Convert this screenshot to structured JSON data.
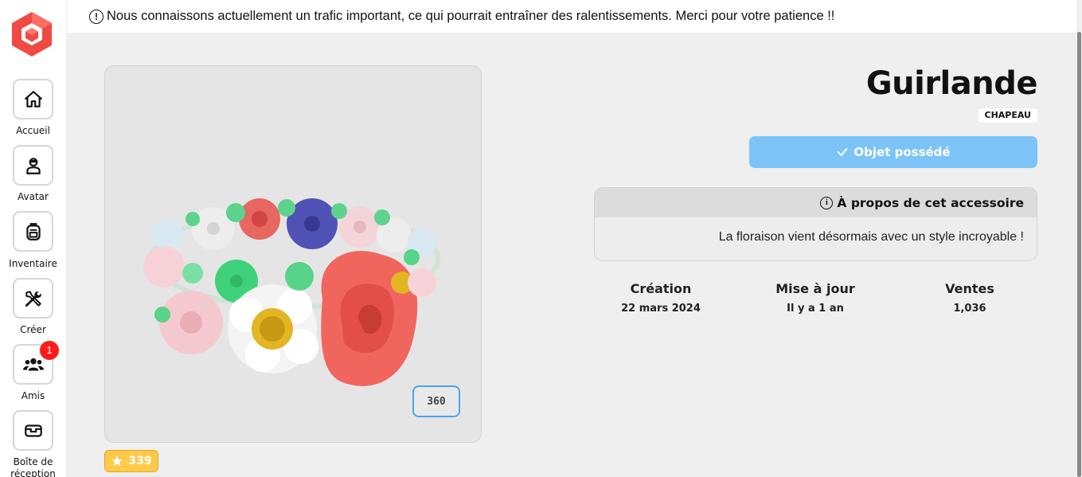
{
  "banner": {
    "icon": "exclamation-circle-icon",
    "text": "Nous connaissons actuellement un trafic important, ce qui pourrait entraîner des ralentissements. Merci pour votre patience !!"
  },
  "sidebar": {
    "logo": "hexagon-cube-logo",
    "accent_color": "#f04a44",
    "items": [
      {
        "label": "Accueil",
        "icon": "home-icon"
      },
      {
        "label": "Avatar",
        "icon": "avatar-icon"
      },
      {
        "label": "Inventaire",
        "icon": "backpack-icon"
      },
      {
        "label": "Créer",
        "icon": "tools-icon"
      },
      {
        "label": "Amis",
        "icon": "friends-icon",
        "badge": "1"
      },
      {
        "label": "Boîte de réception",
        "icon": "inbox-icon"
      }
    ]
  },
  "preview": {
    "button_360": "360",
    "rating": "339",
    "rating_icon": "star-icon"
  },
  "item": {
    "name": "Guirlande",
    "type": "CHAPEAU",
    "owned_label": "Objet possédé",
    "owned_icon": "check-icon",
    "owned_color": "#7cc4f7",
    "about_title": "À propos de cet accessoire",
    "about_text": "La floraison vient désormais avec un style incroyable !"
  },
  "stats": [
    {
      "label": "Création",
      "value": "22 mars 2024"
    },
    {
      "label": "Mise à jour",
      "value": "Il y a 1 an"
    },
    {
      "label": "Ventes",
      "value": "1,036"
    }
  ]
}
